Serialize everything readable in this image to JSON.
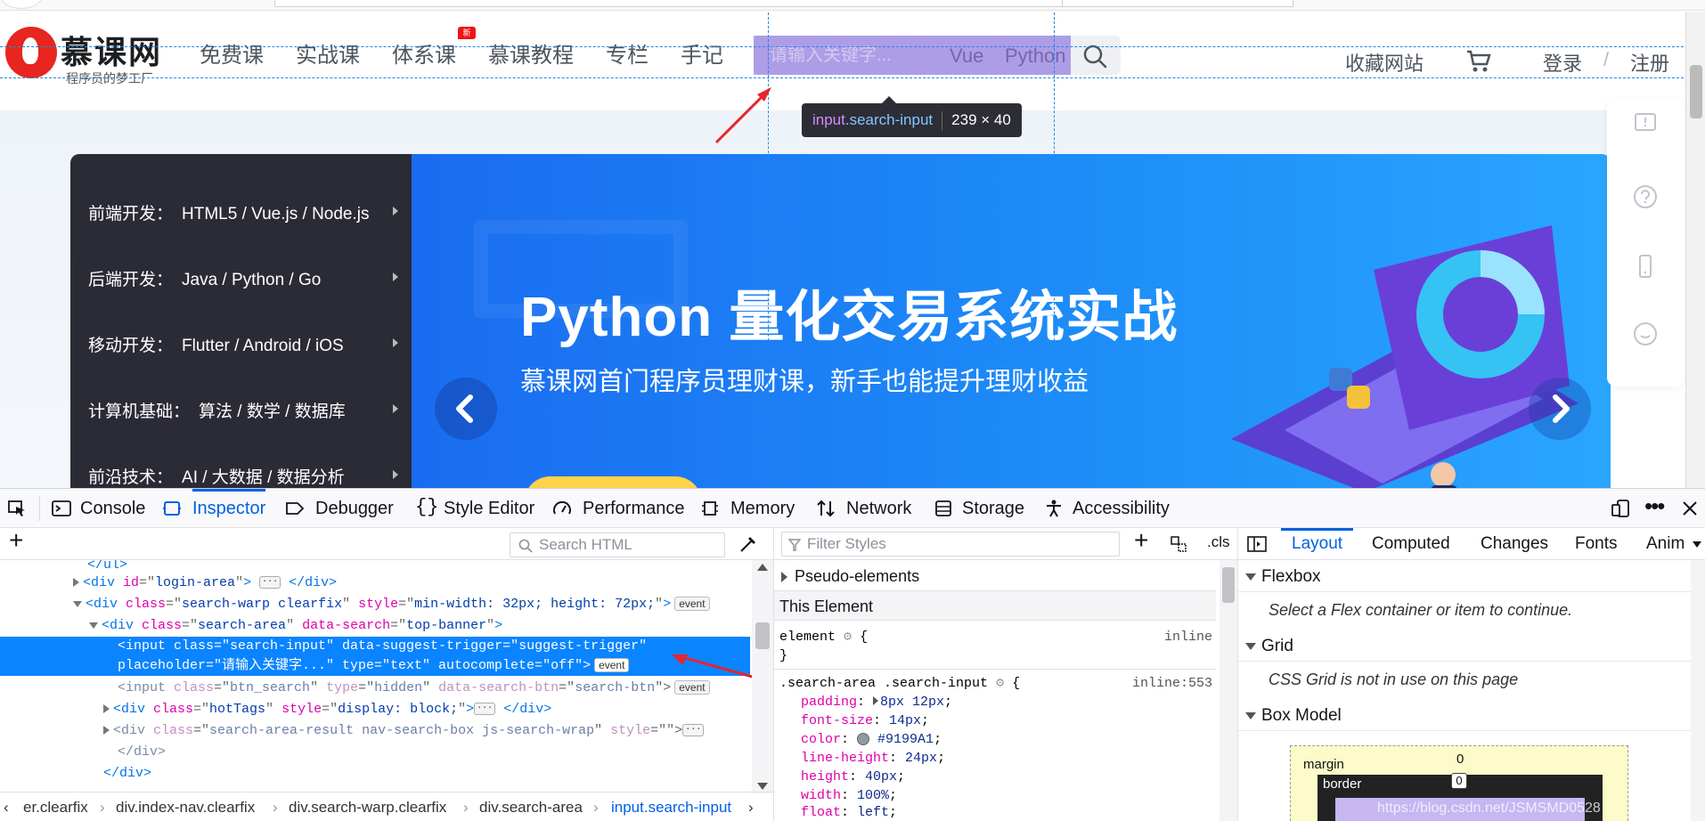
{
  "site": {
    "logo": {
      "name": "慕课网",
      "slogan": "程序员的梦工厂"
    },
    "nav": [
      "免费课",
      "实战课",
      "体系课",
      "慕课教程",
      "专栏",
      "手记"
    ],
    "nav_badge": "新",
    "search": {
      "placeholder": "请输入关键字...",
      "hot_tags": [
        "Vue",
        "Python"
      ]
    },
    "right_nav": {
      "favorite": "收藏网站",
      "login": "登录",
      "divider": "/",
      "register": "注册"
    },
    "inspector_tooltip": {
      "tag": "input",
      "class": ".search-input",
      "size": "239 × 40"
    },
    "side_menu": [
      {
        "category": "前端开发：",
        "items": "HTML5 / Vue.js / Node.js"
      },
      {
        "category": "后端开发：",
        "items": "Java / Python / Go"
      },
      {
        "category": "移动开发：",
        "items": "Flutter / Android / iOS"
      },
      {
        "category": "计算机基础：",
        "items": "算法 / 数学 / 数据库"
      },
      {
        "category": "前沿技术：",
        "items": "AI / 大数据 / 数据分析"
      }
    ],
    "banner": {
      "title": "Python 量化交易系统实战",
      "subtitle": "慕课网首门程序员理财课，新手也能提升理财收益"
    },
    "colors": {
      "brand_red": "#e6261f",
      "banner_blue": "#1d8cf8",
      "highlight": "#785adc"
    }
  },
  "devtools": {
    "tabs": [
      "Console",
      "Inspector",
      "Debugger",
      "Style Editor",
      "Performance",
      "Memory",
      "Network",
      "Storage",
      "Accessibility"
    ],
    "active_tab": "Inspector",
    "search_html_placeholder": "Search HTML",
    "markup": [
      {
        "text": "</ul>"
      },
      {
        "tag": "div",
        "attrs": [
          [
            "id",
            "login-area"
          ]
        ],
        "collapsed": true,
        "close": "</div>"
      },
      {
        "tag": "div",
        "attrs": [
          [
            "class",
            "search-warp clearfix"
          ],
          [
            "style",
            "min-width: 32px; height: 72px;"
          ]
        ],
        "badge": "event"
      },
      {
        "tag": "div",
        "attrs": [
          [
            "class",
            "search-area"
          ],
          [
            "data-search",
            "top-banner"
          ]
        ]
      },
      {
        "line1": "<input class=\"search-input\" data-suggest-trigger=\"suggest-trigger\"",
        "line2": "placeholder=\"请输入关键字...\" type=\"text\" autocomplete=\"off\">",
        "badge": "event"
      },
      {
        "tag": "input",
        "attrs": [
          [
            "class",
            "btn_search"
          ],
          [
            "type",
            "hidden"
          ],
          [
            "data-search-btn",
            "search-btn"
          ]
        ],
        "badge": "event"
      },
      {
        "tag": "div",
        "attrs": [
          [
            "class",
            "hotTags"
          ],
          [
            "style",
            "display: block;"
          ]
        ],
        "collapsed": true,
        "close": "</div>"
      },
      {
        "tag": "div",
        "attrs": [
          [
            "class",
            "search-area-result nav-search-box js-search-wrap"
          ],
          [
            "style",
            ""
          ]
        ],
        "collapsed": true
      },
      {
        "text": "</div>"
      },
      {
        "text": "</div>"
      }
    ],
    "breadcrumbs": [
      "er.clearfix",
      "div.index-nav.clearfix",
      "div.search-warp.clearfix",
      "div.search-area",
      "input.search-input"
    ],
    "rules": {
      "filter_placeholder": "Filter Styles",
      "cls_label": ".cls",
      "pseudo_elements": "Pseudo-elements",
      "this_element": "This Element",
      "element_selector": "element",
      "element_source": "inline",
      "rule_selector": ".search-area .search-input",
      "rule_source": "inline:553",
      "declarations": [
        {
          "prop": "padding",
          "value": "8px 12px"
        },
        {
          "prop": "font-size",
          "value": "14px"
        },
        {
          "prop": "color",
          "value": "#9199A1"
        },
        {
          "prop": "line-height",
          "value": "24px"
        },
        {
          "prop": "height",
          "value": "40px"
        },
        {
          "prop": "width",
          "value": "100%"
        },
        {
          "prop": "float",
          "value": "left"
        }
      ]
    },
    "layout": {
      "tabs": [
        "Layout",
        "Computed",
        "Changes",
        "Fonts",
        "Anim"
      ],
      "flexbox_title": "Flexbox",
      "flexbox_note": "Select a Flex container or item to continue.",
      "grid_title": "Grid",
      "grid_note": "CSS Grid is not in use on this page",
      "boxmodel_title": "Box Model",
      "margin_label": "margin",
      "border_label": "border",
      "margin_value": "0",
      "border_value": "0"
    },
    "watermark": "https://blog.csdn.net/JSMSMD0528"
  }
}
